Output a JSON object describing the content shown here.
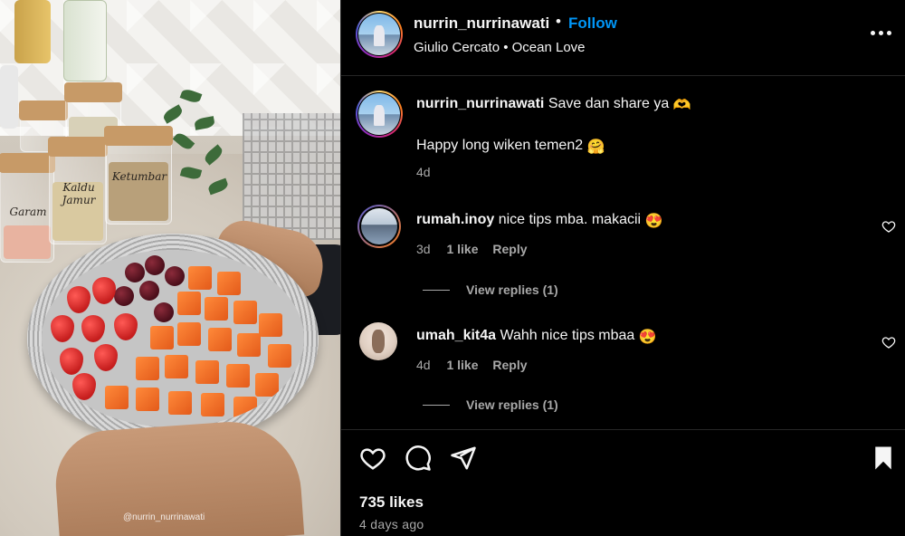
{
  "media": {
    "jar_labels": [
      "Garam",
      "Kaldu Jamur",
      "Ketumbar"
    ],
    "watermark": "@nurrin_nurrinawati"
  },
  "header": {
    "username": "nurrin_nurrinawati",
    "separator": "•",
    "follow_label": "Follow",
    "audio": "Giulio Cercato • Ocean Love",
    "more_icon": "more-options-icon"
  },
  "caption": {
    "username": "nurrin_nurrinawati",
    "line1": "Save dan share ya",
    "line1_emoji": "🫶",
    "line2": "Happy long wiken temen2",
    "line2_emoji": "🤗",
    "time": "4d"
  },
  "comments": [
    {
      "username": "rumah.inoy",
      "text": "nice tips mba. makacii",
      "emoji": "😍",
      "time": "3d",
      "likes": "1 like",
      "reply_label": "Reply",
      "view_replies": "View replies (1)"
    },
    {
      "username": "umah_kit4a",
      "text": "Wahh nice tips mbaa",
      "emoji": "😍",
      "time": "4d",
      "likes": "1 like",
      "reply_label": "Reply",
      "view_replies": "View replies (1)"
    }
  ],
  "footer": {
    "likes": "735 likes",
    "posted": "4 days ago"
  },
  "colors": {
    "follow": "#0095f6",
    "background": "#000000",
    "muted": "#a8a8a8"
  }
}
